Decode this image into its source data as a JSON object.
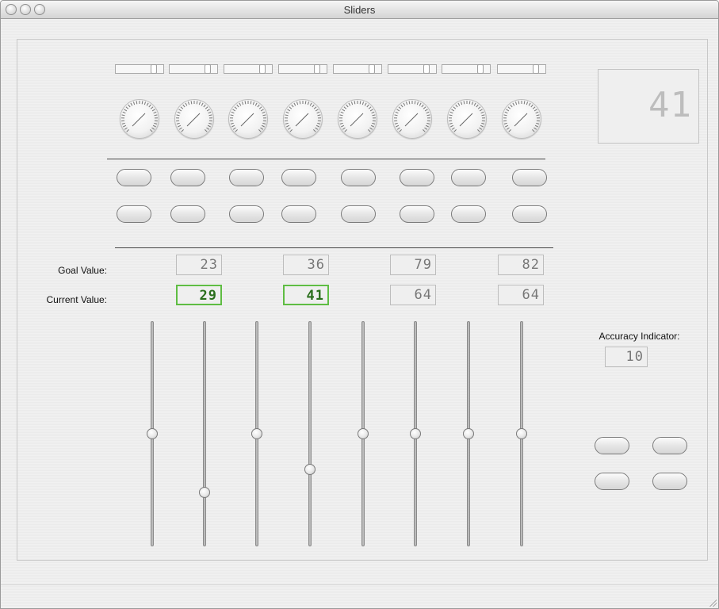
{
  "window": {
    "title": "Sliders"
  },
  "labels": {
    "goal": "Goal Value:",
    "current": "Current Value:",
    "accuracy": "Accuracy Indicator:"
  },
  "display_big": "41",
  "goal_values": [
    "23",
    "36",
    "79",
    "82"
  ],
  "current_values": [
    "29",
    "41",
    "64",
    "64"
  ],
  "accuracy_value": "10",
  "slider_levels": [
    0.5,
    0.24,
    0.5,
    0.34,
    0.5,
    0.5,
    0.5,
    0.5
  ],
  "colors": {
    "active_border": "#5fbd43",
    "active_text": "#2b6f1d"
  }
}
